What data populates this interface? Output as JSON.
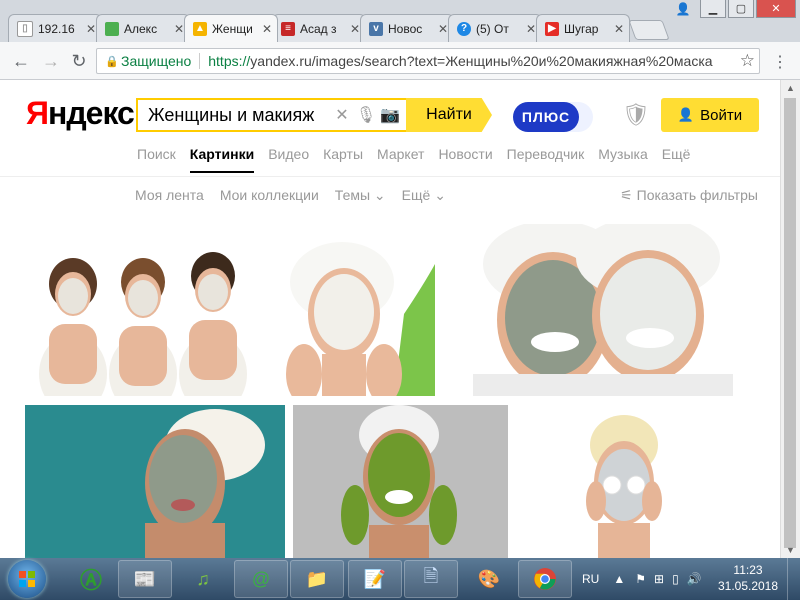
{
  "browser": {
    "tabs": [
      {
        "label": "192.16",
        "favicon": "page-icon",
        "color": "#ffffff"
      },
      {
        "label": "Алекс",
        "favicon": "green-square-icon",
        "color": "#4caf50"
      },
      {
        "label": "Женщи",
        "favicon": "image-icon",
        "color": "#f5b400",
        "active": true
      },
      {
        "label": "Асад з",
        "favicon": "news-icon",
        "color": "#c62828"
      },
      {
        "label": "Новос",
        "favicon": "vk-icon",
        "color": "#4a76a8"
      },
      {
        "label": "(5) От",
        "favicon": "question-icon",
        "color": "#1e88e5"
      },
      {
        "label": "Шугар",
        "favicon": "youtube-icon",
        "color": "#e52d27"
      }
    ],
    "secure_label": "Защищено",
    "url_scheme": "https://",
    "url_rest": "yandex.ru/images/search?text=Женщины%20и%20макияжная%20маска"
  },
  "yandex": {
    "logo_first": "Я",
    "logo_rest": "ндекс",
    "search_query": "Женщины и макияж",
    "find_label": "Найти",
    "plus_label": "ПЛЮС",
    "login_label": "Войти",
    "services": [
      "Поиск",
      "Картинки",
      "Видео",
      "Карты",
      "Маркет",
      "Новости",
      "Переводчик",
      "Музыка",
      "Ещё"
    ],
    "active_service": "Картинки",
    "filters": [
      "Моя лента",
      "Мои коллекции",
      "Темы ⌄",
      "Ещё ⌄"
    ],
    "show_filters": "Показать фильтры"
  },
  "results": [
    {
      "mask": "#e8e4dc",
      "bg": "#ffffff",
      "skin": "#e7b79a"
    },
    {
      "mask": "#f2f0ea",
      "bg": "#ffffff",
      "skin": "#e9b99b"
    },
    {
      "mask": "#e9ebe8",
      "bg": "#ffffff",
      "skin": "#e4b08f"
    },
    {
      "mask": "#8f9a8a",
      "bg": "#2a8b8f",
      "skin": "#c48c6c"
    },
    {
      "mask": "#6e9a2c",
      "bg": "#bdbdbd",
      "skin": "#c98f6d"
    },
    {
      "mask": "#cfd3d6",
      "bg": "#ffffff",
      "skin": "#e6b597"
    }
  ],
  "taskbar": {
    "lang": "RU",
    "time": "11:23",
    "date": "31.05.2018"
  }
}
